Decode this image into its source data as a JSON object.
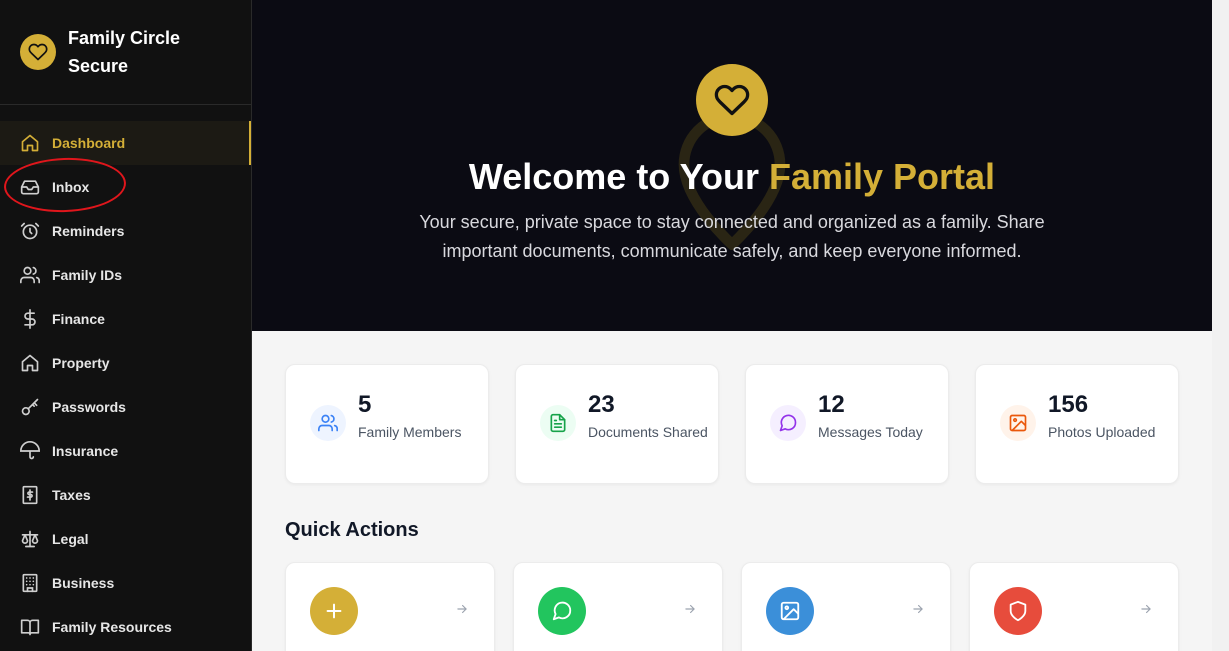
{
  "brand": {
    "name": "Family Circle Secure",
    "logo_icon": "heart-icon",
    "accent": "#d4af37"
  },
  "sidebar": {
    "items": [
      {
        "label": "Dashboard",
        "icon": "home-icon",
        "active": true
      },
      {
        "label": "Inbox",
        "icon": "inbox-icon"
      },
      {
        "label": "Reminders",
        "icon": "alarm-clock-icon"
      },
      {
        "label": "Family IDs",
        "icon": "users-icon"
      },
      {
        "label": "Finance",
        "icon": "dollar-icon"
      },
      {
        "label": "Property",
        "icon": "house-icon"
      },
      {
        "label": "Passwords",
        "icon": "key-icon"
      },
      {
        "label": "Insurance",
        "icon": "umbrella-icon"
      },
      {
        "label": "Taxes",
        "icon": "receipt-icon"
      },
      {
        "label": "Legal",
        "icon": "scale-icon"
      },
      {
        "label": "Business",
        "icon": "building-icon"
      },
      {
        "label": "Family Resources",
        "icon": "book-icon"
      }
    ]
  },
  "hero": {
    "title_prefix": "Welcome to Your ",
    "title_accent": "Family Portal",
    "subtitle": "Your secure, private space to stay connected and organized as a family. Share important documents, communicate safely, and keep everyone informed.",
    "icon": "heart-icon"
  },
  "stats": [
    {
      "value": "5",
      "label": "Family Members",
      "icon": "users-icon",
      "color": "#3b82f6"
    },
    {
      "value": "23",
      "label": "Documents Shared",
      "icon": "file-text-icon",
      "color": "#16a34a"
    },
    {
      "value": "12",
      "label": "Messages Today",
      "icon": "message-circle-icon",
      "color": "#9333ea"
    },
    {
      "value": "156",
      "label": "Photos Uploaded",
      "icon": "image-icon",
      "color": "#ea580c"
    }
  ],
  "quick_actions": {
    "title": "Quick Actions",
    "items": [
      {
        "icon": "plus-icon",
        "color": "#d4af37"
      },
      {
        "icon": "chat-icon",
        "color": "#22c55e"
      },
      {
        "icon": "image-icon",
        "color": "#3b8fd9"
      },
      {
        "icon": "shield-icon",
        "color": "#e74c3c"
      }
    ]
  }
}
